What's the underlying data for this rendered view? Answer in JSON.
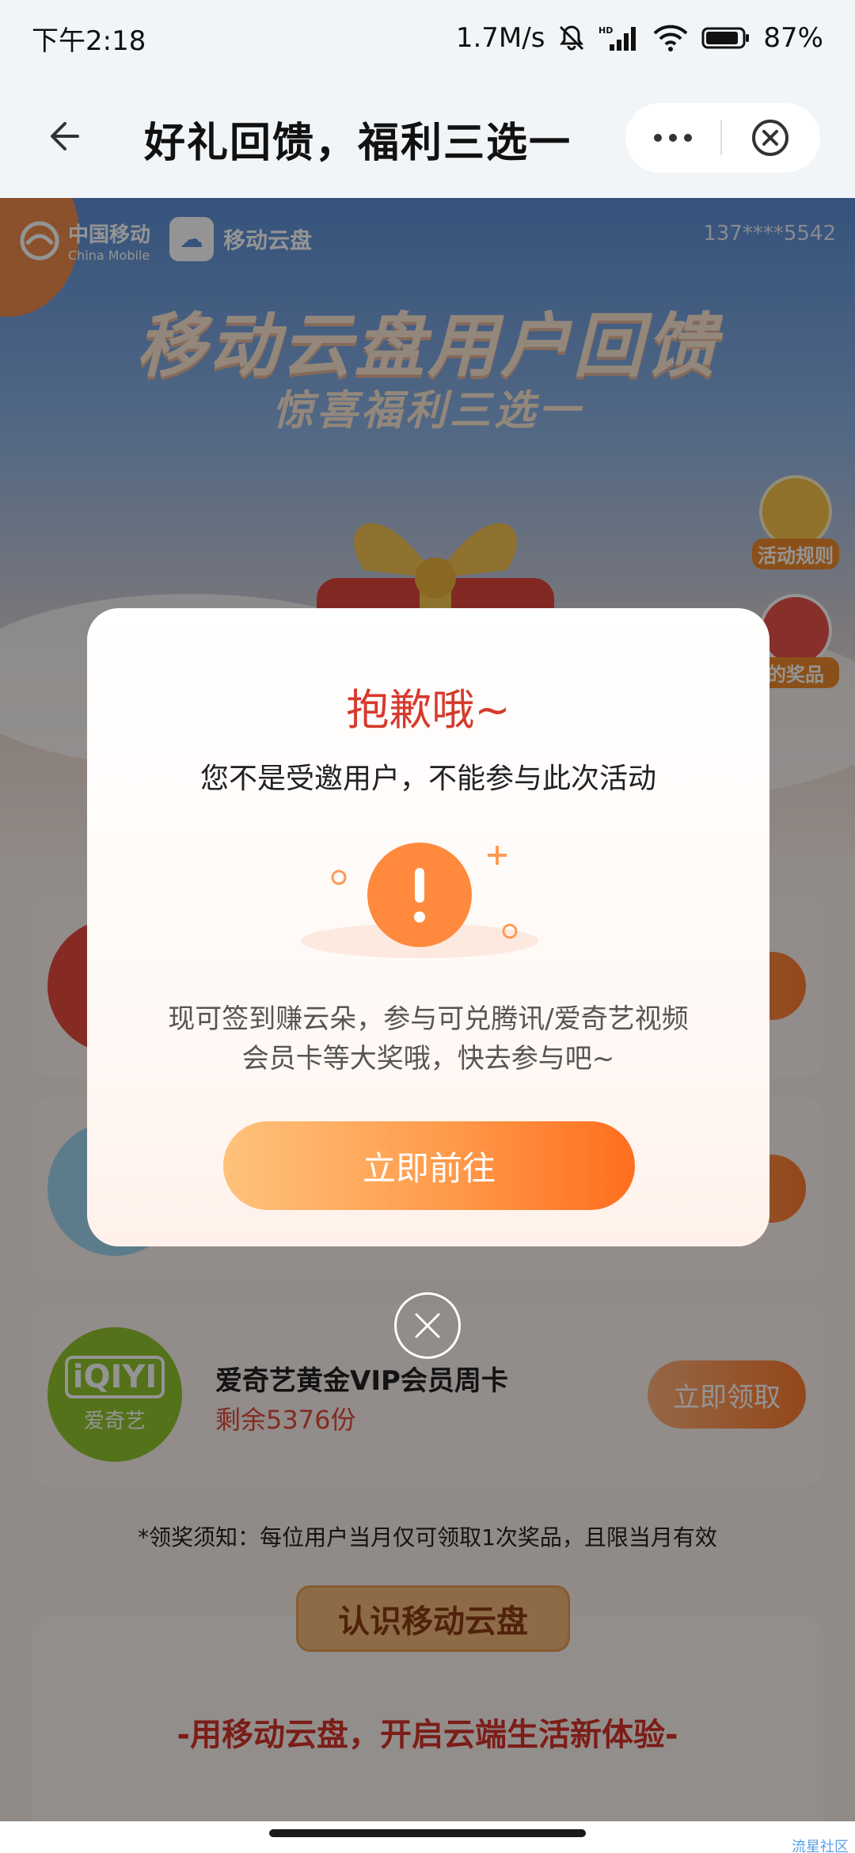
{
  "status_bar": {
    "time": "下午2:18",
    "net_speed": "1.7M/s",
    "battery": "87%"
  },
  "nav": {
    "title": "好礼回馈，福利三选一"
  },
  "page": {
    "china_mobile": "中国移动",
    "china_mobile_en": "China Mobile",
    "cloud_logo_text": "移动云盘",
    "phone": "137****5542",
    "hero_title": "移动云盘用户回馈",
    "hero_subtitle": "惊喜福利三选一",
    "rules_label": "活动规则",
    "prize_label": "的奖品",
    "cards": [
      {
        "title": "爱奇艺黄金VIP会员周卡",
        "remain": "剩余5376份",
        "button": "立即领取",
        "logo_big": "iQIYI",
        "logo_small": "爱奇艺"
      }
    ],
    "notice": "*领奖须知：每位用户当月仅可领取1次奖品，且限当月有效",
    "know_title": "认识移动云盘",
    "slogan": "-用移动云盘，开启云端生活新体验-"
  },
  "modal": {
    "title": "抱歉哦~",
    "message": "您不是受邀用户，不能参与此次活动",
    "desc_line1": "现可签到赚云朵，参与可兑腾讯/爱奇艺视频",
    "desc_line2": "会员卡等大奖哦，快去参与吧~",
    "go_button": "立即前往"
  },
  "watermark": "流星社区",
  "colors": {
    "accent_orange": "#ff7a2d",
    "title_red": "#d63a2d"
  }
}
